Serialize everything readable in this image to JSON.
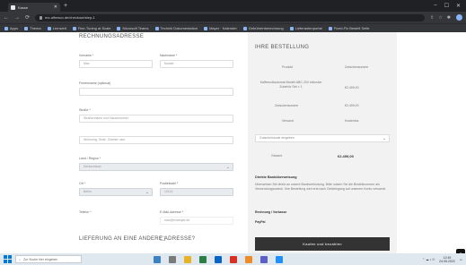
{
  "browser": {
    "tab_title": "Kasse",
    "tab_close": "✕",
    "new_tab": "+",
    "win_min": "–",
    "win_max": "☐",
    "win_close": "✕",
    "url": "mz-alfresco.de/checkout/step-1",
    "bookmarks": [
      "Apps",
      "Thema",
      "Lernwelt",
      "Fine-Tuning at Scale",
      "Microsoft Teams",
      "Technik Dokumentation",
      "Mayer · Kalender",
      "Gebührenberechnung",
      "Lieferantenportal",
      "Fixed-Fix Bestell Seite"
    ]
  },
  "form": {
    "billing_title": "Rechnungsadresse",
    "first_name_label": "Vorname *",
    "first_name_value": "Max",
    "last_name_label": "Nachname *",
    "last_name_value": "Muster",
    "company_label": "Firmenname (optional)",
    "street_label": "Straße *",
    "street_placeholder": "Straßenname und Hausnummer",
    "street2_placeholder": "Wohnung, Suite, Zimmer usw.",
    "country_label": "Land / Region *",
    "country_value": "Deutschland",
    "city_label": "Ort *",
    "city_value": "Berlin",
    "zip_label": "Postleitzahl *",
    "zip_value": "10115",
    "phone_label": "Telefon *",
    "email_label": "E-Mail-Adresse *",
    "email_value": "max@example.de",
    "shipping_title": "Lieferung an eine andere Adresse?",
    "shipping_check": "☐"
  },
  "summary": {
    "title": "Ihre Bestellung",
    "col_product": "Produkt",
    "col_total": "Zwischensumme",
    "item_label": "Kaffeevollautomat Modell ABC-200 inklusive Zubehör Set × 1",
    "item_price": "€2.499,00",
    "subtotal_label": "Zwischensumme",
    "subtotal_value": "€2.499,00",
    "shipping_label": "Versand",
    "shipping_value": "Kostenlos",
    "coupon_placeholder": "Gutscheincode eingeben",
    "total_label": "Gesamt",
    "total_value": "€2.499,00",
    "bank_title": "Direkte Banküberweisung",
    "bank_text": "Überweisen Sie direkt an unsere Bankverbindung. Bitte nutzen Sie die Bestellnummer als Verwendungszweck. Ihre Bestellung wird erst nach Geldeingang auf unserem Konto versandt.",
    "method_label": "Rechnung / Vorkasse",
    "paypal_label": "PayPal",
    "submit_label": "Kaufen und bezahlen"
  },
  "chat": {
    "icon": "◆"
  },
  "taskbar": {
    "search_placeholder": "Zur Suche hier eingeben",
    "time": "12:45",
    "date": "24.05.2022",
    "tray_icons": "⌃ ☁ ♪ ⎚"
  },
  "colors": {
    "accent": "#0078d4",
    "button": "#333333",
    "summary_bg": "#f2f2f2"
  }
}
